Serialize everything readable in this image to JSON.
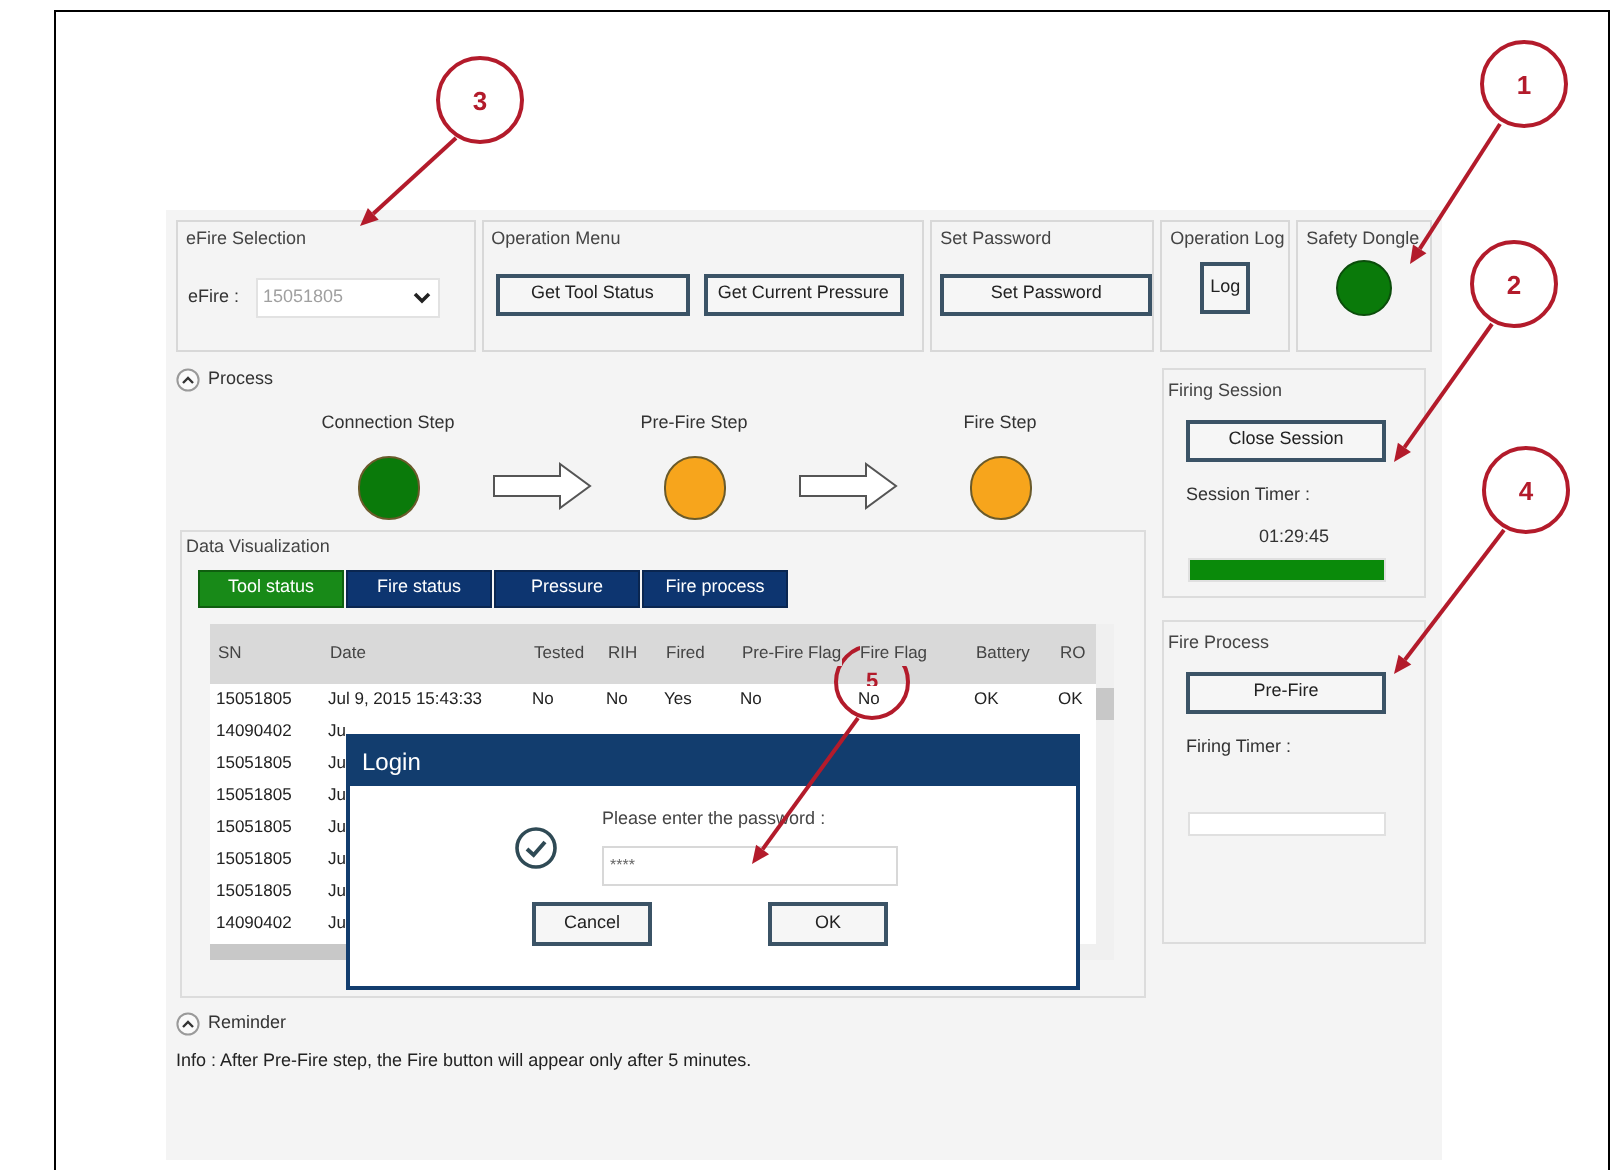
{
  "efire_selection": {
    "title": "eFire Selection",
    "label": "eFire :",
    "value": "15051805"
  },
  "operation_menu": {
    "title": "Operation Menu",
    "buttons": [
      "Get Tool Status",
      "Get Current Pressure"
    ]
  },
  "set_password": {
    "title": "Set Password",
    "button": "Set Password"
  },
  "operation_log": {
    "title": "Operation Log",
    "button": "Log"
  },
  "safety_dongle": {
    "title": "Safety Dongle",
    "color": "#0a7a0a"
  },
  "process": {
    "title": "Process",
    "expanded": true,
    "steps": [
      {
        "label": "Connection Step",
        "color": "#0a7a0a"
      },
      {
        "label": "Pre-Fire Step",
        "color": "#f7a51c"
      },
      {
        "label": "Fire Step",
        "color": "#f7a51c"
      }
    ]
  },
  "data_visualization": {
    "title": "Data Visualization",
    "tabs": [
      {
        "label": "Tool status",
        "selected": true
      },
      {
        "label": "Fire status",
        "selected": false
      },
      {
        "label": "Pressure",
        "selected": false
      },
      {
        "label": "Fire process",
        "selected": false
      }
    ],
    "table": {
      "columns": [
        "SN",
        "Date",
        "Tested",
        "RIH",
        "Fired",
        "Pre-Fire Flag",
        "Fire Flag",
        "Battery",
        "RO"
      ],
      "rows": [
        [
          "15051805",
          "Jul 9, 2015  15:43:33",
          "No",
          "No",
          "Yes",
          "No",
          "No",
          "OK",
          "OK"
        ],
        [
          "14090402",
          "Ju"
        ],
        [
          "15051805",
          "Ju"
        ],
        [
          "15051805",
          "Ju"
        ],
        [
          "15051805",
          "Ju"
        ],
        [
          "15051805",
          "Ju"
        ],
        [
          "15051805",
          "Ju"
        ],
        [
          "14090402",
          "Ju"
        ]
      ]
    }
  },
  "firing_session": {
    "title": "Firing Session",
    "button": "Close Session",
    "timer_label": "Session Timer :",
    "timer": "01:29:45",
    "level": 1
  },
  "fire_process": {
    "title": "Fire Process",
    "button": "Pre-Fire",
    "timer_label": "Firing Timer :",
    "level": 0
  },
  "reminder": {
    "title": "Reminder",
    "expanded": true,
    "info": "Info : After Pre-Fire step, the Fire button will appear only after 5 minutes."
  },
  "login_dialog": {
    "title": "Login",
    "prompt": "Please enter the password :",
    "password": "****",
    "buttons": [
      "Cancel",
      "OK"
    ]
  },
  "annotations": [
    {
      "label": "3"
    },
    {
      "label": "1"
    },
    {
      "label": "2"
    },
    {
      "label": "4"
    },
    {
      "label": "5"
    }
  ]
}
